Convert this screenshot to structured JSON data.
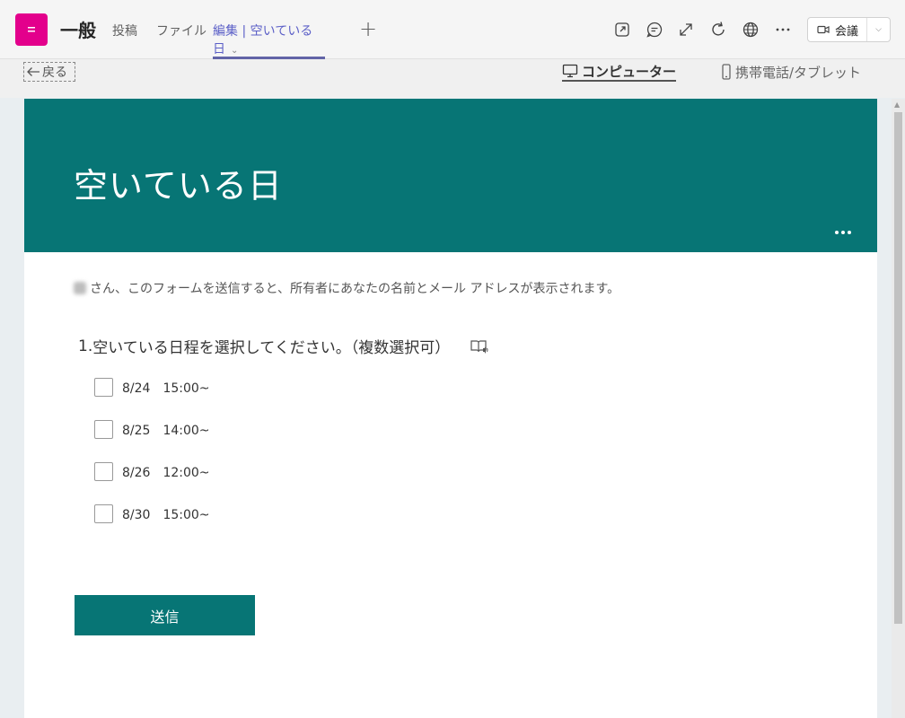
{
  "header": {
    "channel_name": "一般",
    "tabs": [
      {
        "label": "投稿"
      },
      {
        "label": "ファイル"
      },
      {
        "label": "編集 | 空いている日"
      }
    ],
    "add_tab_symbol": "+",
    "meet_label": "会議",
    "icons": [
      "popout-icon",
      "chat-icon",
      "expand-icon",
      "refresh-icon",
      "globe-icon",
      "more-icon",
      "video-camera-icon",
      "chevron-down-icon"
    ]
  },
  "subbar": {
    "back_label": "戻る",
    "view_computer_label": "コンピューター",
    "view_mobile_label": "携帯電話/タブレット"
  },
  "form": {
    "title": "空いている日",
    "notice_text": "さん、このフォームを送信すると、所有者にあなたの名前とメール アドレスが表示されます。",
    "question_number": "1.",
    "question_text": "空いている日程を選択してください。（複数選択可）",
    "options": [
      {
        "label": "8/24　15:00~"
      },
      {
        "label": "8/25　14:00~"
      },
      {
        "label": "8/26　12:00~"
      },
      {
        "label": "8/30　15:00~"
      }
    ],
    "submit_label": "送信"
  },
  "colors": {
    "banner": "#077575",
    "team_avatar": "#e3008c",
    "active_tab": "#5b5fc7"
  }
}
